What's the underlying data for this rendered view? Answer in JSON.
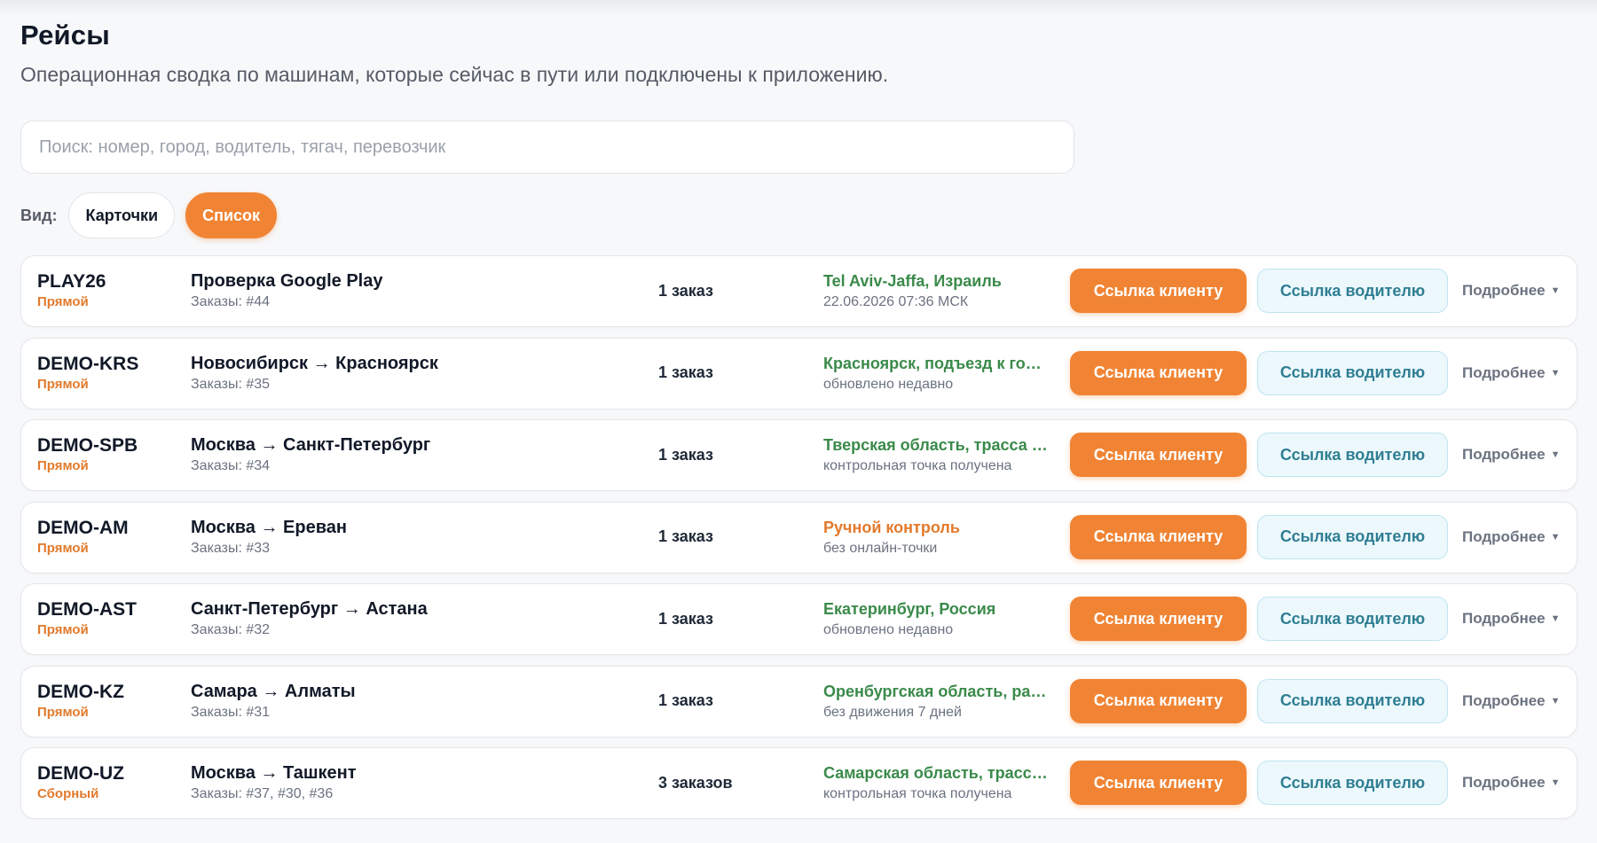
{
  "page": {
    "title": "Рейсы",
    "subtitle": "Операционная сводка по машинам, которые сейчас в пути или подключены к приложению."
  },
  "search": {
    "placeholder": "Поиск: номер, город, водитель, тягач, перевозчик",
    "value": ""
  },
  "view": {
    "label": "Вид:",
    "cards_label": "Карточки",
    "list_label": "Список",
    "active": "list"
  },
  "colors": {
    "accent": "#f08434",
    "location_ok": "#3a8a4a",
    "driver_button_bg": "#ecf8fc"
  },
  "trips": [
    {
      "plate": "PLAY26",
      "type": "Прямой",
      "route": "Проверка Google Play",
      "orders": "Заказы: #44",
      "count": "1 заказ",
      "location": "Tel Aviv-Jaffa, Израиль",
      "location_sub": "22.06.2026 07:36 МСК",
      "status": "ok",
      "client_btn": "Ссылка клиенту",
      "driver_btn": "Ссылка водителю",
      "more": "Подробнее"
    },
    {
      "plate": "DEMO-KRS",
      "type": "Прямой",
      "route": "Новосибирск → Красноярск",
      "orders": "Заказы: #35",
      "count": "1 заказ",
      "location": "Красноярск, подъезд к го…",
      "location_sub": "обновлено недавно",
      "status": "ok",
      "client_btn": "Ссылка клиенту",
      "driver_btn": "Ссылка водителю",
      "more": "Подробнее"
    },
    {
      "plate": "DEMO-SPB",
      "type": "Прямой",
      "route": "Москва → Санкт-Петербург",
      "orders": "Заказы: #34",
      "count": "1 заказ",
      "location": "Тверская область, трасса …",
      "location_sub": "контрольная точка получена",
      "status": "ok",
      "client_btn": "Ссылка клиенту",
      "driver_btn": "Ссылка водителю",
      "more": "Подробнее"
    },
    {
      "plate": "DEMO-AM",
      "type": "Прямой",
      "route": "Москва → Ереван",
      "orders": "Заказы: #33",
      "count": "1 заказ",
      "location": "Ручной контроль",
      "location_sub": "без онлайн-точки",
      "status": "warn",
      "client_btn": "Ссылка клиенту",
      "driver_btn": "Ссылка водителю",
      "more": "Подробнее"
    },
    {
      "plate": "DEMO-AST",
      "type": "Прямой",
      "route": "Санкт-Петербург → Астана",
      "orders": "Заказы: #32",
      "count": "1 заказ",
      "location": "Екатеринбург, Россия",
      "location_sub": "обновлено недавно",
      "status": "ok",
      "client_btn": "Ссылка клиенту",
      "driver_btn": "Ссылка водителю",
      "more": "Подробнее"
    },
    {
      "plate": "DEMO-KZ",
      "type": "Прямой",
      "route": "Самара → Алматы",
      "orders": "Заказы: #31",
      "count": "1 заказ",
      "location": "Оренбургская область, ра…",
      "location_sub": "без движения 7 дней",
      "status": "ok",
      "client_btn": "Ссылка клиенту",
      "driver_btn": "Ссылка водителю",
      "more": "Подробнее"
    },
    {
      "plate": "DEMO-UZ",
      "type": "Сборный",
      "route": "Москва → Ташкент",
      "orders": "Заказы: #37, #30, #36",
      "count": "3 заказов",
      "location": "Самарская область, трасс…",
      "location_sub": "контрольная точка получена",
      "status": "ok",
      "client_btn": "Ссылка клиенту",
      "driver_btn": "Ссылка водителю",
      "more": "Подробнее"
    }
  ]
}
